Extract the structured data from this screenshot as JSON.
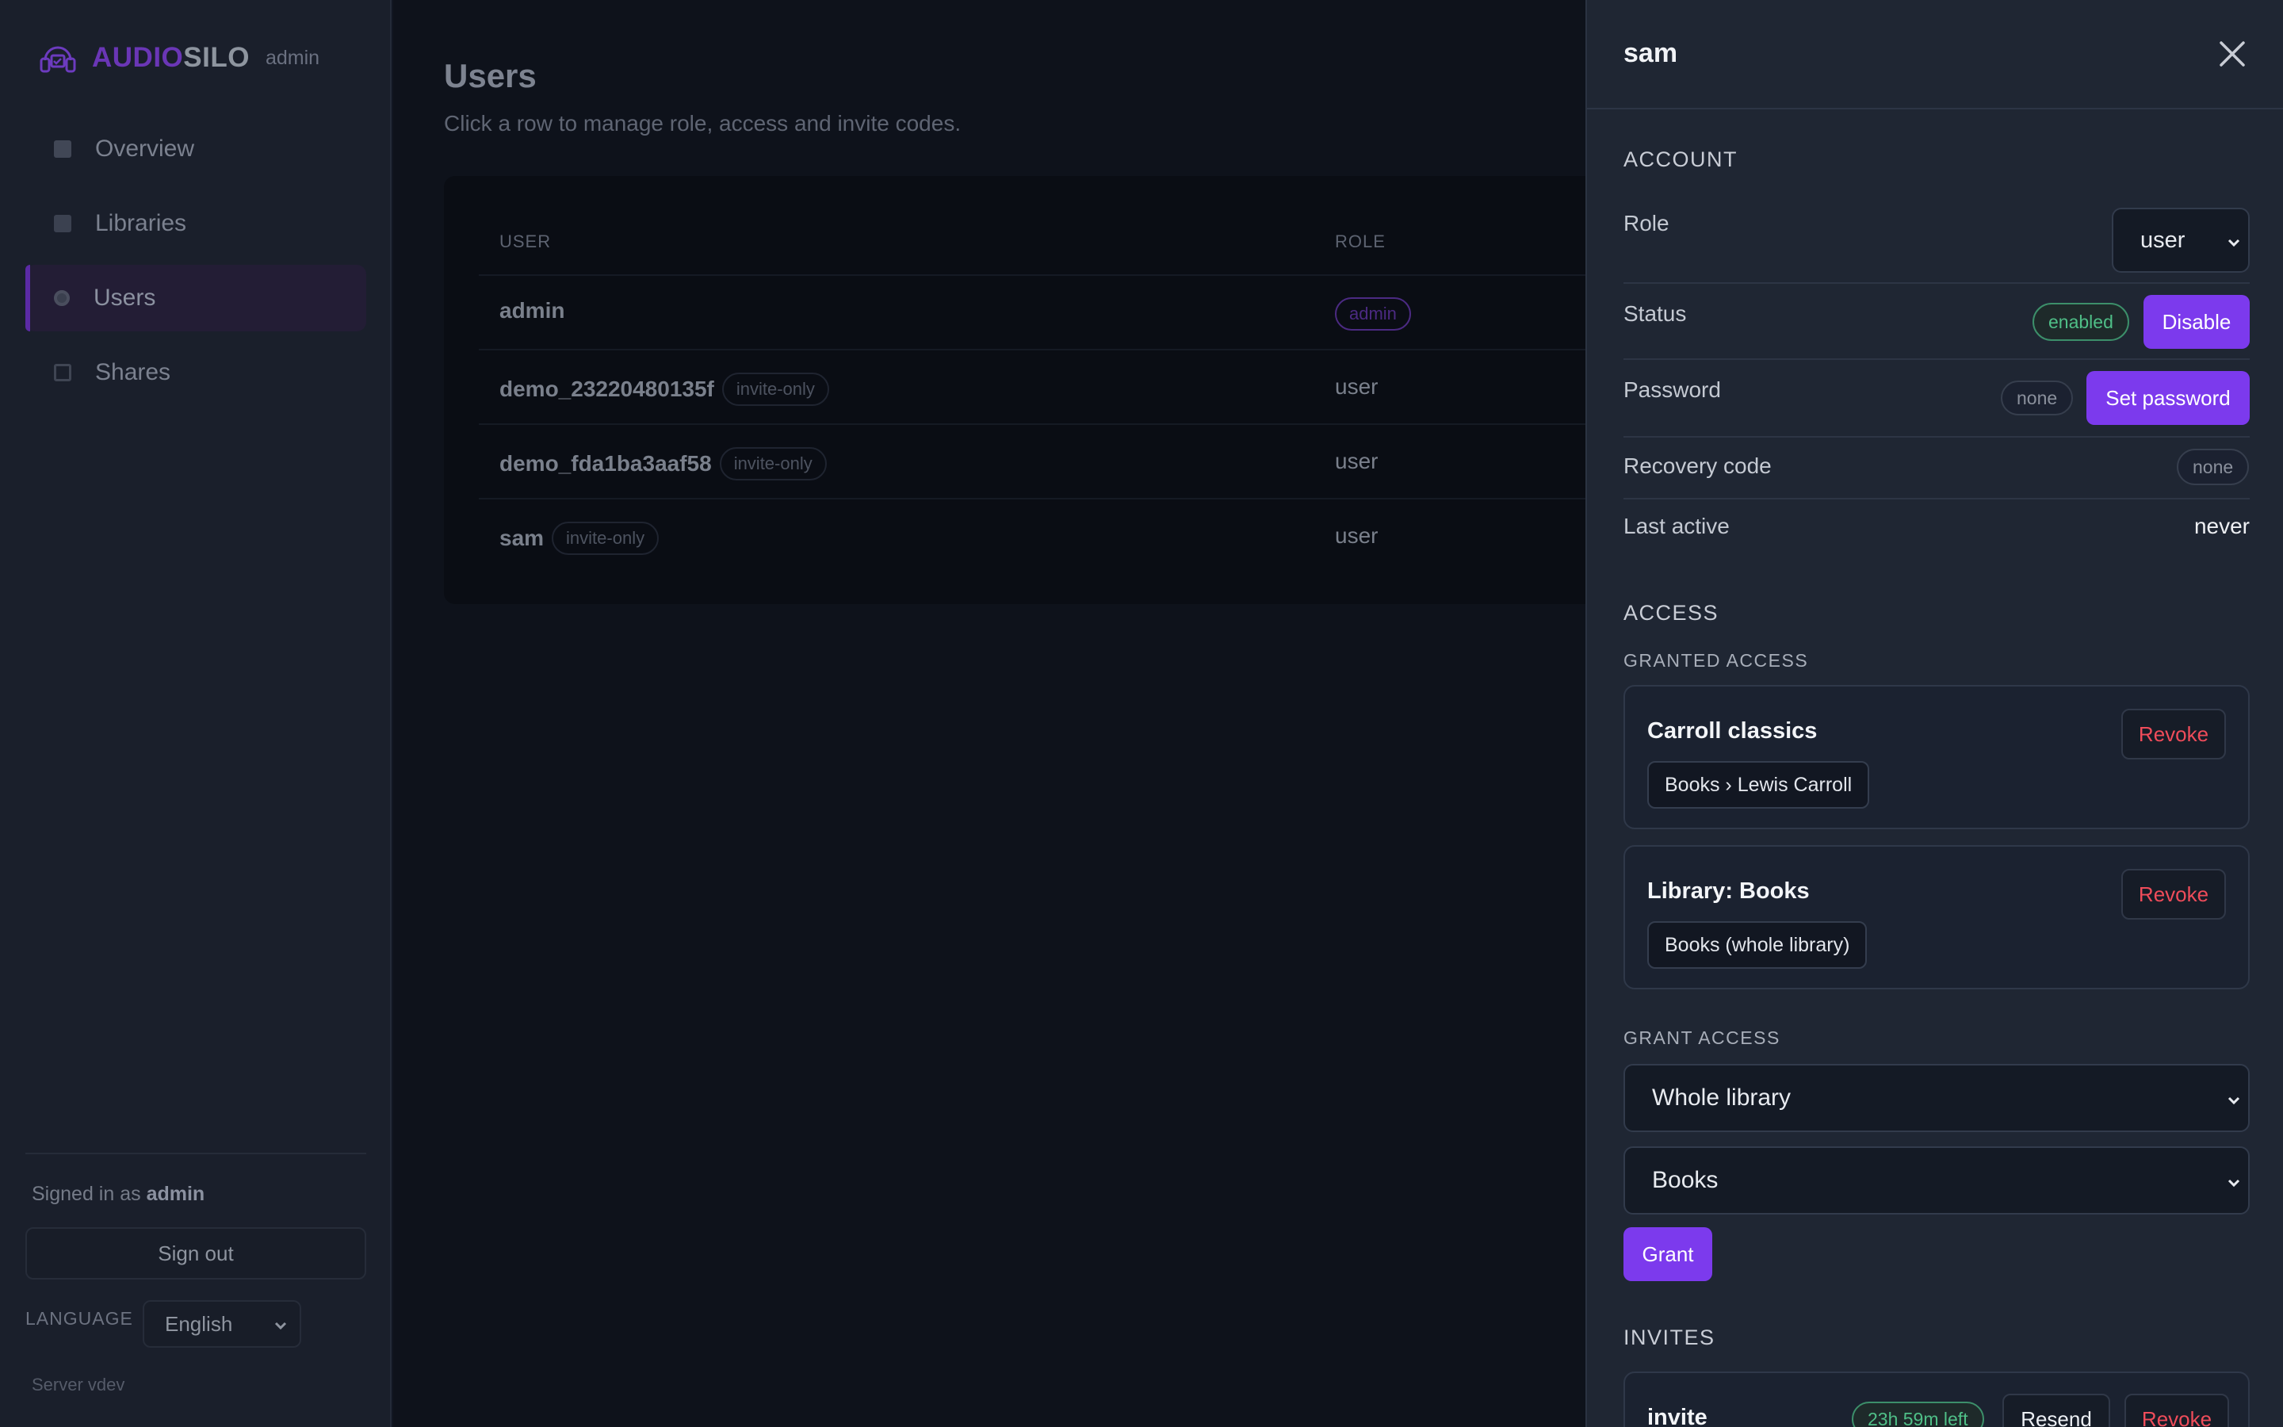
{
  "app": {
    "brand_part1": "AUDIO",
    "brand_part2": "SILO",
    "brand_role": "admin",
    "accent_color": "#7c3aed"
  },
  "sidebar": {
    "items": [
      {
        "label": "Overview",
        "icon": "square-icon"
      },
      {
        "label": "Libraries",
        "icon": "library-icon"
      },
      {
        "label": "Users",
        "icon": "users-icon",
        "active": true
      },
      {
        "label": "Shares",
        "icon": "shares-icon"
      }
    ],
    "signed_in_prefix": "Signed in as",
    "signed_in_user": "admin",
    "sign_out_label": "Sign out",
    "language_label": "LANGUAGE",
    "language_value": "English",
    "server_version": "Server vdev"
  },
  "main": {
    "title": "Users",
    "subtitle": "Click a row to manage role, access and invite codes.",
    "columns": [
      "USER",
      "ROLE"
    ],
    "rows": [
      {
        "user": "admin",
        "tag": "",
        "role_badge": "admin",
        "role": ""
      },
      {
        "user": "demo_23220480135f",
        "tag": "invite-only",
        "role_badge": "",
        "role": "user"
      },
      {
        "user": "demo_fda1ba3aaf58",
        "tag": "invite-only",
        "role_badge": "",
        "role": "user"
      },
      {
        "user": "sam",
        "tag": "invite-only",
        "role_badge": "",
        "role": "user"
      }
    ]
  },
  "drawer": {
    "title": "sam",
    "account": {
      "section_label": "ACCOUNT",
      "role_label": "Role",
      "role_value": "user",
      "status_label": "Status",
      "status_value": "enabled",
      "disable_label": "Disable",
      "password_label": "Password",
      "password_value": "none",
      "set_password_label": "Set password",
      "recovery_label": "Recovery code",
      "recovery_value": "none",
      "last_active_label": "Last active",
      "last_active_value": "never"
    },
    "access": {
      "section_label": "ACCESS",
      "granted_label": "GRANTED ACCESS",
      "grants": [
        {
          "name": "Carroll classics",
          "chip": "Books › Lewis Carroll",
          "revoke": "Revoke"
        },
        {
          "name": "Library: Books",
          "chip": "Books (whole library)",
          "revoke": "Revoke"
        }
      ],
      "grant_label": "GRANT ACCESS",
      "scope_value": "Whole library",
      "library_value": "Books",
      "grant_button": "Grant"
    },
    "invites": {
      "section_label": "INVITES",
      "name": "invite",
      "expires": "23h 59m left",
      "resend_label": "Resend",
      "revoke_label": "Revoke"
    }
  }
}
